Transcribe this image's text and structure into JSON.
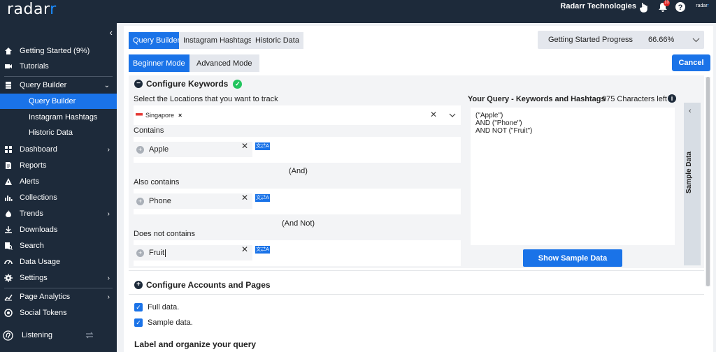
{
  "app": {
    "logo_main": "radar",
    "logo_accent": "r",
    "company": "Radarr Technologies",
    "notification_count": "10",
    "mini_logo_main": "radar",
    "mini_logo_accent": "r"
  },
  "sidebar": {
    "items": [
      {
        "label": "Getting Started (9%)",
        "icon": "home-icon"
      },
      {
        "label": "Tutorials",
        "icon": "video-icon"
      },
      {
        "label": "Query Builder",
        "icon": "database-icon"
      },
      {
        "label": "Query Builder"
      },
      {
        "label": "Instagram Hashtags"
      },
      {
        "label": "Historic Data"
      },
      {
        "label": "Dashboard",
        "icon": "grid-icon"
      },
      {
        "label": "Reports",
        "icon": "document-icon"
      },
      {
        "label": "Alerts",
        "icon": "warning-icon"
      },
      {
        "label": "Collections",
        "icon": "collections-icon"
      },
      {
        "label": "Trends",
        "icon": "flame-icon"
      },
      {
        "label": "Downloads",
        "icon": "download-icon"
      },
      {
        "label": "Search",
        "icon": "search-icon"
      },
      {
        "label": "Data Usage",
        "icon": "gauge-icon"
      },
      {
        "label": "Settings",
        "icon": "gear-icon"
      },
      {
        "label": "Page Analytics",
        "icon": "analytics-icon"
      },
      {
        "label": "Social Tokens",
        "icon": "token-icon"
      },
      {
        "label": "Listening",
        "icon": "listening-icon"
      }
    ]
  },
  "tabs": [
    "Query Builder",
    "Instagram Hashtags",
    "Historic Data"
  ],
  "modes": [
    "Beginner Mode",
    "Advanced Mode"
  ],
  "progress": {
    "label": "Getting Started Progress",
    "value": "66.66%"
  },
  "cancel_label": "Cancel",
  "configure_keywords": {
    "title": "Configure Keywords",
    "locations_label": "Select the Locations that you want to track",
    "location_chip": "Singapore",
    "contains_label": "Contains",
    "contains_value": "Apple",
    "and_label": "(And)",
    "also_label": "Also contains",
    "also_value": "Phone",
    "andnot_label": "(And Not)",
    "notcontains_label": "Does not contains",
    "notcontains_value": "Fruit"
  },
  "query": {
    "title": "Your Query - Keywords and Hashtags",
    "chars_left": "975 Characters left",
    "lines": [
      "(\"Apple\")",
      "AND  (\"Phone\")",
      "AND NOT  (\"Fruit\")"
    ]
  },
  "sample_data_label": "Sample Data",
  "show_sample_label": "Show Sample Data",
  "configure_accounts": {
    "title": "Configure Accounts and Pages"
  },
  "checkboxes": [
    "Full data.",
    "Sample data."
  ],
  "label_organize": "Label and organize your query",
  "colors": {
    "accent": "#1a73e8",
    "sidebar": "#1d2a3a",
    "success": "#22c55e"
  }
}
